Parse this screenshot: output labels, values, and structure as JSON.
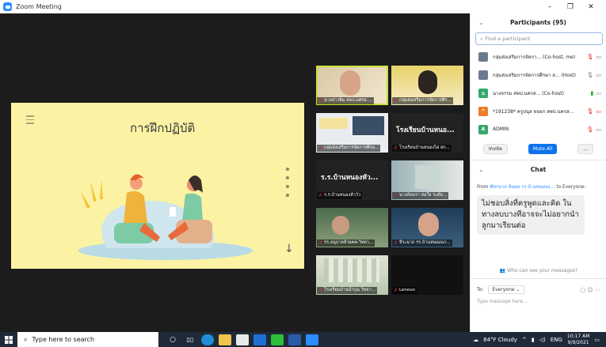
{
  "window": {
    "title": "Zoom Meeting",
    "minimize": "–",
    "maximize": "❐",
    "close": "✕"
  },
  "share": {
    "slide_title": "การฝึกปฏิบัติ",
    "arrow": "↓"
  },
  "gallery": [
    {
      "name": "นางสาวพิม สพป.มศรส....",
      "big": ""
    },
    {
      "name": "กลุ่มส่งเสริมการจัดการศึก...",
      "big": ""
    },
    {
      "name": "กลุ่มส่งเสริมการจัดการศึกษ...",
      "big": ""
    },
    {
      "name": "โรงเรียนบ้านหนองไผ่ สก...",
      "big": "โรงเรียนบ้านหนอ..."
    },
    {
      "name": "ร.ร.บ้านหนองหัววัว",
      "big": "ร.ร.บ้านหนองหัว..."
    },
    {
      "name": "นางอัจฉรา สมใจ ระดับ...",
      "big": ""
    },
    {
      "name": "รร.อนุบาลห้วยคต-วิทยา...",
      "big": ""
    },
    {
      "name": "จีระนาถ รร.บ้านหนองแก...",
      "big": ""
    },
    {
      "name": "โรงเรียนบ้านน้ำบุน วิทยา...",
      "big": ""
    },
    {
      "name": "Lenovo",
      "big": ""
    }
  ],
  "participants": {
    "header": "Participants (95)",
    "search_placeholder": "Find a participant",
    "rows": [
      {
        "name": "กลุ่มส่งเสริมการจัดกา... (Co-host, me)",
        "avatar": ""
      },
      {
        "name": "กลุ่มส่งเสริมการจัดการศึกษา ส... (Host)",
        "avatar": ""
      },
      {
        "name": "นางจรรม สพป.นครส... (Co-host)",
        "avatar": "น"
      },
      {
        "name": "*191238* ครูปนุส หอยก สพป.นครส...",
        "avatar": "*"
      },
      {
        "name": "ADMIN",
        "avatar": "A"
      }
    ],
    "invite": "Invite",
    "mute_all": "Mute All",
    "more": "..."
  },
  "chat": {
    "header": "Chat",
    "from_prefix": "From",
    "from_user": "พัชรนาภ อินผล รร.บ้านหนองแ...",
    "to_label": "to Everyone:",
    "message": "ไม่ชอบสิ่งที่ครูพูดและคิด ในทางลบบางทีอาจจะไม่อยากนำลูกมาเรียนต่อ",
    "who_can_see": "Who can see your messages?",
    "to": "To:",
    "to_value": "Everyone",
    "input_placeholder": "Type message here..."
  },
  "taskbar": {
    "search_placeholder": "Type here to search",
    "weather": "84°F Cloudy",
    "lang": "ENG",
    "time": "10:17 AM",
    "date": "9/9/2021"
  },
  "colors": {
    "accent": "#0e72ed",
    "mute_red": "#e02828",
    "slide_bg": "#fbf2a4"
  }
}
